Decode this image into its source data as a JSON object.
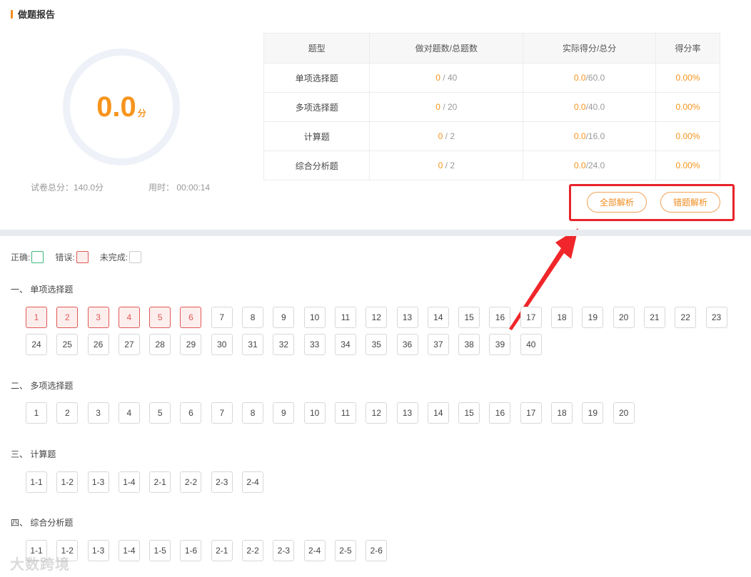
{
  "header": {
    "title": "做题报告"
  },
  "score": {
    "value": "0.0",
    "unit": "分"
  },
  "meta": {
    "total": "试卷总分：140.0分",
    "time": "用时：  00:00:14"
  },
  "table": {
    "headers": [
      "题型",
      "做对题数/总题数",
      "实际得分/总分",
      "得分率"
    ],
    "rows": [
      {
        "type": "单项选择题",
        "correct": "0",
        "count": " / 40",
        "got": "0.0",
        "full": "/60.0",
        "rate": "0.00%"
      },
      {
        "type": "多项选择题",
        "correct": "0",
        "count": " / 20",
        "got": "0.0",
        "full": "/40.0",
        "rate": "0.00%"
      },
      {
        "type": "计算题",
        "correct": "0",
        "count": " / 2",
        "got": "0.0",
        "full": "/16.0",
        "rate": "0.00%"
      },
      {
        "type": "综合分析题",
        "correct": "0",
        "count": " / 2",
        "got": "0.0",
        "full": "/24.0",
        "rate": "0.00%"
      }
    ]
  },
  "buttons": {
    "all_analysis": "全部解析",
    "wrong_analysis": "错题解析"
  },
  "legend": {
    "correct": "正确:",
    "wrong": "错误:",
    "todo": "未完成:"
  },
  "sections": [
    {
      "title": "一、 单项选择题",
      "rows": [
        [
          "1",
          "2",
          "3",
          "4",
          "5",
          "6",
          "7",
          "8",
          "9",
          "10",
          "11",
          "12",
          "13",
          "14",
          "15",
          "16",
          "17",
          "18",
          "19",
          "20",
          "21",
          "22",
          "23"
        ],
        [
          "24",
          "25",
          "26",
          "27",
          "28",
          "29",
          "30",
          "31",
          "32",
          "33",
          "34",
          "35",
          "36",
          "37",
          "38",
          "39",
          "40"
        ]
      ],
      "wrong": [
        "1",
        "2",
        "3",
        "4",
        "5",
        "6"
      ]
    },
    {
      "title": "二、 多项选择题",
      "rows": [
        [
          "1",
          "2",
          "3",
          "4",
          "5",
          "6",
          "7",
          "8",
          "9",
          "10",
          "11",
          "12",
          "13",
          "14",
          "15",
          "16",
          "17",
          "18",
          "19",
          "20"
        ]
      ],
      "wrong": []
    },
    {
      "title": "三、 计算题",
      "rows": [
        [
          "1-1",
          "1-2",
          "1-3",
          "1-4",
          "2-1",
          "2-2",
          "2-3",
          "2-4"
        ]
      ],
      "wrong": []
    },
    {
      "title": "四、 综合分析题",
      "rows": [
        [
          "1-1",
          "1-2",
          "1-3",
          "1-4",
          "1-5",
          "1-6",
          "2-1",
          "2-2",
          "2-3",
          "2-4",
          "2-5",
          "2-6"
        ]
      ],
      "wrong": []
    }
  ],
  "watermark": "大数跨境",
  "colors": {
    "accent": "#f7941d",
    "wrong": "#e05a55",
    "correct": "#3bb87a",
    "highlight": "#e8232a"
  }
}
